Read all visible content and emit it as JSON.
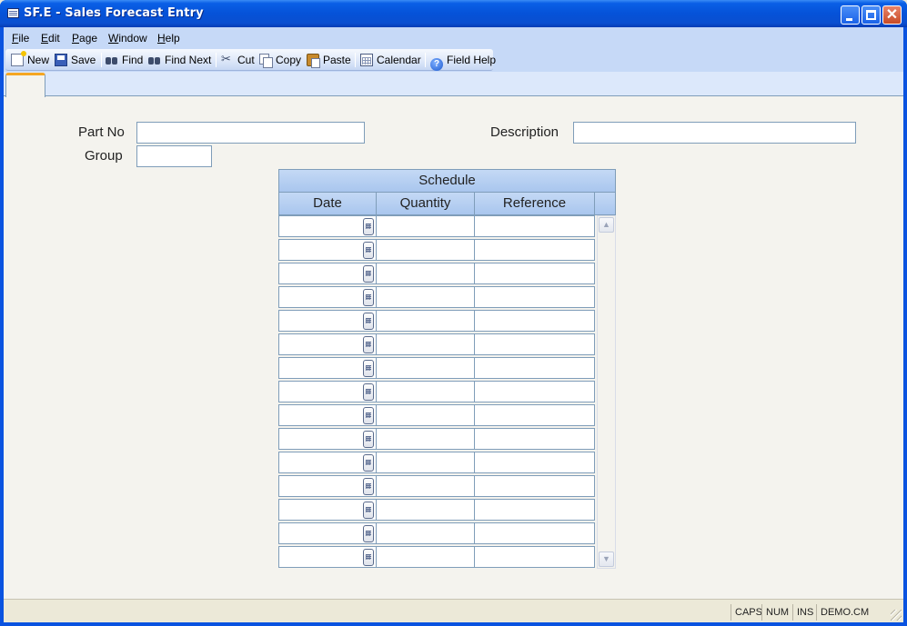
{
  "window": {
    "title": "SF.E - Sales Forecast Entry",
    "minimize_glyph": "",
    "maximize_glyph": "",
    "close_glyph": "✕"
  },
  "menu": {
    "file": {
      "accel": "F",
      "rest": "ile"
    },
    "edit": {
      "accel": "E",
      "rest": "dit"
    },
    "page": {
      "accel": "P",
      "rest": "age"
    },
    "window": {
      "accel": "W",
      "rest": "indow"
    },
    "help": {
      "accel": "H",
      "rest": "elp"
    }
  },
  "toolbar": {
    "new": "New",
    "save": "Save",
    "find": "Find",
    "find_next": "Find Next",
    "cut": "Cut",
    "copy": "Copy",
    "paste": "Paste",
    "calendar": "Calendar",
    "field_help": "Field Help",
    "help_glyph": "?"
  },
  "form": {
    "part_no_label": "Part No",
    "part_no_value": "",
    "description_label": "Description",
    "description_value": "",
    "group_label": "Group",
    "group_value": ""
  },
  "schedule": {
    "title": "Schedule",
    "columns": [
      "Date",
      "Quantity",
      "Reference"
    ],
    "row_count": 15,
    "scroll_up_glyph": "▲",
    "scroll_down_glyph": "▼"
  },
  "status": {
    "caps": "CAPS",
    "num": "NUM",
    "ins": "INS",
    "account": "DEMO.CM"
  },
  "colors": {
    "title_bar": "#0552d8",
    "band": "#c6d9f7",
    "active_tab_accent": "#f5a623",
    "grid_header": "#a9c6ee"
  }
}
